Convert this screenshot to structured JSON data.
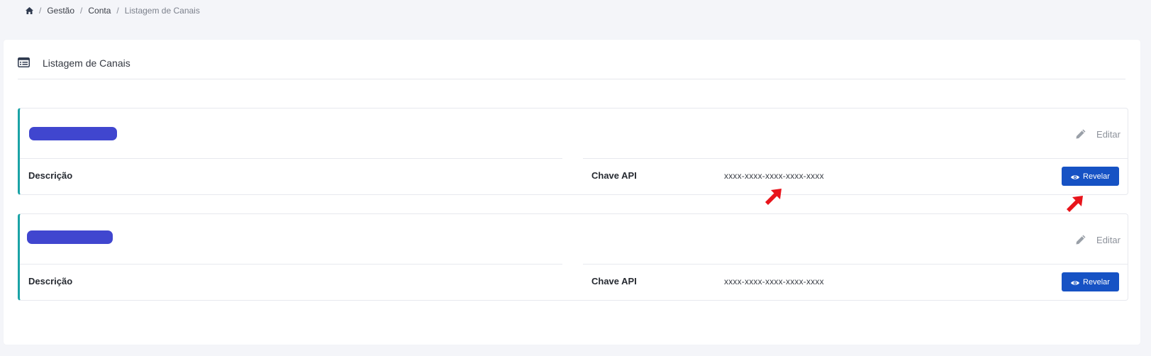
{
  "breadcrumb": {
    "home_icon": "home-icon",
    "items": [
      "Gestão",
      "Conta"
    ],
    "current": "Listagem de Canais"
  },
  "panel": {
    "icon": "list-icon",
    "title": "Listagem de Canais"
  },
  "channels": [
    {
      "edit_label": "Editar",
      "description_label": "Descrição",
      "api_key_label": "Chave API",
      "api_key_value": "xxxx-xxxx-xxxx-xxxx-xxxx",
      "reveal_label": "Revelar"
    },
    {
      "edit_label": "Editar",
      "description_label": "Descrição",
      "api_key_label": "Chave API",
      "api_key_value": "xxxx-xxxx-xxxx-xxxx-xxxx",
      "reveal_label": "Revelar"
    }
  ],
  "colors": {
    "page_background": "#f4f5f9",
    "card_accent": "#1aa3a6",
    "name_redaction": "#4046cf",
    "primary_button": "#1652c4",
    "annotation_arrow": "#e8141b"
  }
}
